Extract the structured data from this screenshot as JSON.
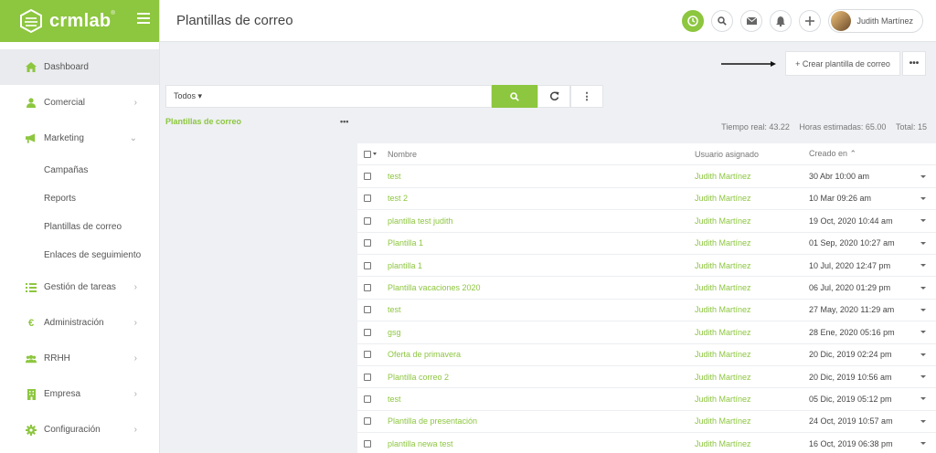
{
  "brand": {
    "name": "crmlab",
    "mark": "®"
  },
  "sidebar": {
    "items": [
      {
        "label": "Dashboard",
        "icon": "home-icon",
        "active": true
      },
      {
        "label": "Comercial",
        "icon": "user-icon",
        "chevron": "›"
      },
      {
        "label": "Marketing",
        "icon": "megaphone-icon",
        "chevron": "⌄"
      },
      {
        "label": "Campañas",
        "sub": true
      },
      {
        "label": "Reports",
        "sub": true
      },
      {
        "label": "Plantillas de correo",
        "sub": true
      },
      {
        "label": "Enlaces de seguimiento",
        "sub": true
      },
      {
        "label": "Gestión de tareas",
        "icon": "tasks-icon",
        "chevron": "›"
      },
      {
        "label": "Administración",
        "icon": "euro-icon",
        "chevron": "›"
      },
      {
        "label": "RRHH",
        "icon": "users-icon",
        "chevron": "›"
      },
      {
        "label": "Empresa",
        "icon": "building-icon",
        "chevron": "›"
      },
      {
        "label": "Configuración",
        "icon": "gear-icon",
        "chevron": "›"
      }
    ]
  },
  "header": {
    "title": "Plantillas de correo",
    "user_name": "Judith Martínez"
  },
  "toolbar": {
    "create_label": "+ Crear plantilla de correo",
    "more_label": "•••",
    "filter_value": "Todos ▾",
    "menu_dots": "⋮"
  },
  "folder": {
    "label": "Plantillas de correo",
    "more": "•••"
  },
  "stats": {
    "real": "Tiempo real: 43.22",
    "estimated": "Horas estimadas: 65.00",
    "total": "Total: 15"
  },
  "table": {
    "headers": {
      "name": "Nombre",
      "user": "Usuario asignado",
      "created": "Creado en ⌃"
    },
    "rows": [
      {
        "name": "test",
        "user": "Judith Martínez",
        "created": "30 Abr 10:00 am"
      },
      {
        "name": "test 2",
        "user": "Judith Martínez",
        "created": "10 Mar 09:26 am"
      },
      {
        "name": "plantilla test judith",
        "user": "Judith Martínez",
        "created": "19 Oct, 2020 10:44 am"
      },
      {
        "name": "Plantilla 1",
        "user": "Judith Martínez",
        "created": "01 Sep, 2020 10:27 am"
      },
      {
        "name": "plantilla 1",
        "user": "Judith Martínez",
        "created": "10 Jul, 2020 12:47 pm"
      },
      {
        "name": "Plantilla vacaciones 2020",
        "user": "Judith Martínez",
        "created": "06 Jul, 2020 01:29 pm"
      },
      {
        "name": "test",
        "user": "Judith Martínez",
        "created": "27 May, 2020 11:29 am"
      },
      {
        "name": "gsg",
        "user": "Judith Martínez",
        "created": "28 Ene, 2020 05:16 pm"
      },
      {
        "name": "Oferta de primavera",
        "user": "Judith Martínez",
        "created": "20 Dic, 2019 02:24 pm"
      },
      {
        "name": "Plantilla correo 2",
        "user": "Judith Martínez",
        "created": "20 Dic, 2019 10:56 am"
      },
      {
        "name": "test",
        "user": "Judith Martínez",
        "created": "05 Dic, 2019 05:12 pm"
      },
      {
        "name": "Plantilla de presentación",
        "user": "Judith Martínez",
        "created": "24 Oct, 2019 10:57 am"
      },
      {
        "name": "plantilla newa test",
        "user": "Judith Martínez",
        "created": "16 Oct, 2019 06:38 pm"
      }
    ]
  },
  "colors": {
    "accent": "#8dc63f",
    "background": "#eef0f3"
  }
}
